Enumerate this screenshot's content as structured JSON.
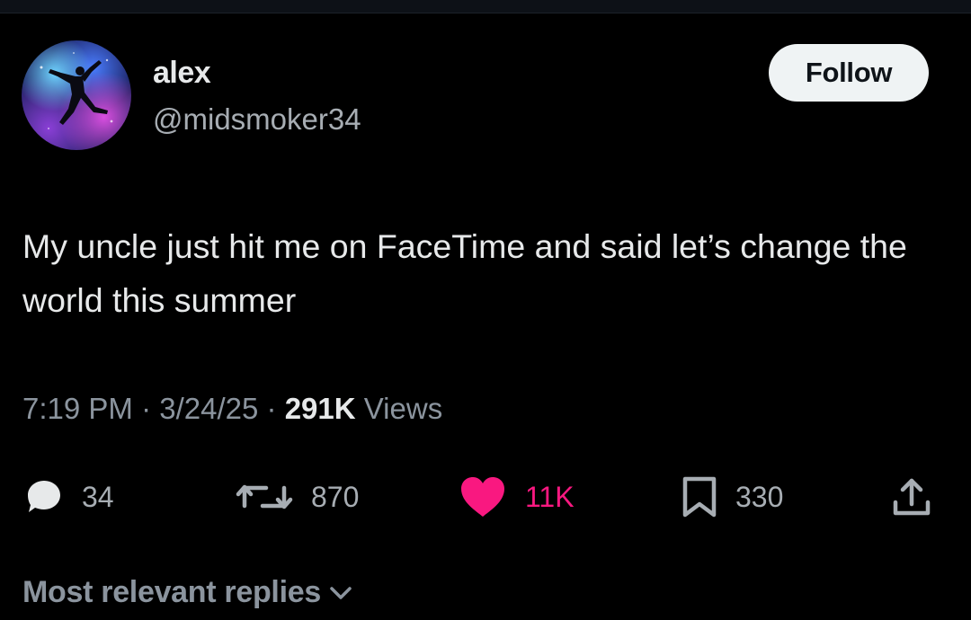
{
  "user": {
    "display_name": "alex",
    "handle": "@midsmoker34",
    "avatar_icon": "jumpman-logo-on-galaxy"
  },
  "follow_button": {
    "label": "Follow"
  },
  "tweet": {
    "text": "My uncle just hit me on FaceTime and said let’s change the world this summer",
    "time": "7:19 PM",
    "date": "3/24/25",
    "separator": "·",
    "views_count": "291K",
    "views_label": "Views"
  },
  "actions": {
    "replies": {
      "icon": "reply-bubble-icon",
      "count": "34"
    },
    "reposts": {
      "icon": "repost-icon",
      "count": "870"
    },
    "likes": {
      "icon": "heart-icon",
      "count": "11K",
      "color": "#f91880",
      "liked": true
    },
    "bookmarks": {
      "icon": "bookmark-icon",
      "count": "330"
    },
    "share": {
      "icon": "share-icon"
    }
  },
  "replies_sort": {
    "label": "Most relevant replies"
  },
  "colors": {
    "background": "#000000",
    "primary_text": "#e7e9ea",
    "secondary_text": "#8b949e",
    "like": "#f91880"
  }
}
